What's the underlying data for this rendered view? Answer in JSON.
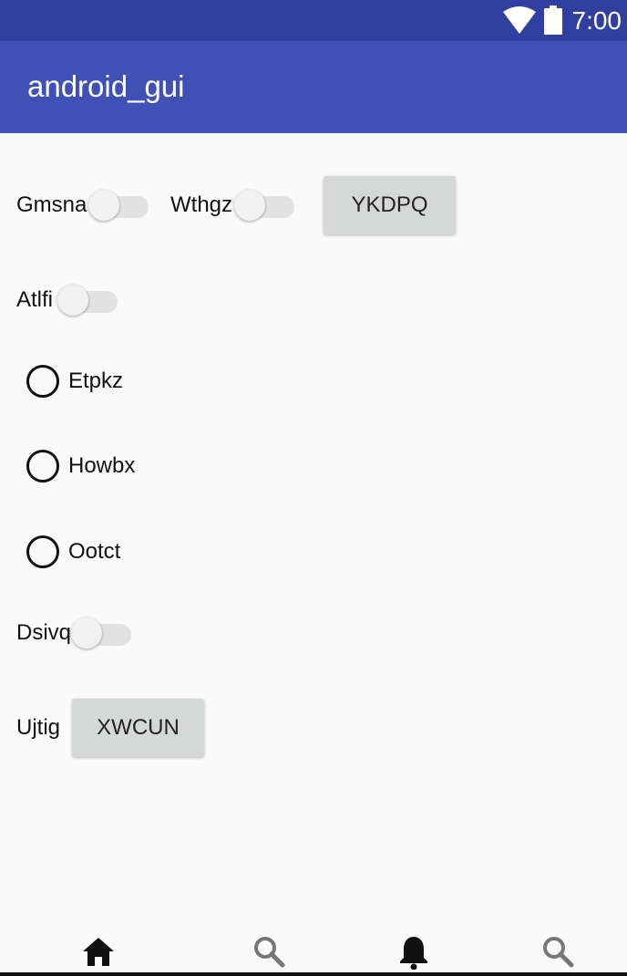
{
  "status": {
    "time": "7:00",
    "wifi_icon": "wifi-icon",
    "battery_icon": "battery-icon"
  },
  "app": {
    "title": "android_gui"
  },
  "row1": {
    "switch1_label": "Gmsna",
    "switch2_label": "Wthgz",
    "button_label": "YKDPQ"
  },
  "row2": {
    "switch_label": "Atlfi"
  },
  "radios": {
    "r1": "Etpkz",
    "r2": "Howbx",
    "r3": "Ootct"
  },
  "row3": {
    "switch_label": "Dsivq"
  },
  "row4": {
    "label": "Ujtig",
    "button_label": "XWCUN"
  },
  "bottom_nav": {
    "items": [
      "home-icon",
      "search-icon",
      "bell-icon",
      "search-icon"
    ]
  },
  "colors": {
    "status_bar": "#3140a0",
    "app_bar": "#3f51b5",
    "button": "#d6d7d7"
  }
}
